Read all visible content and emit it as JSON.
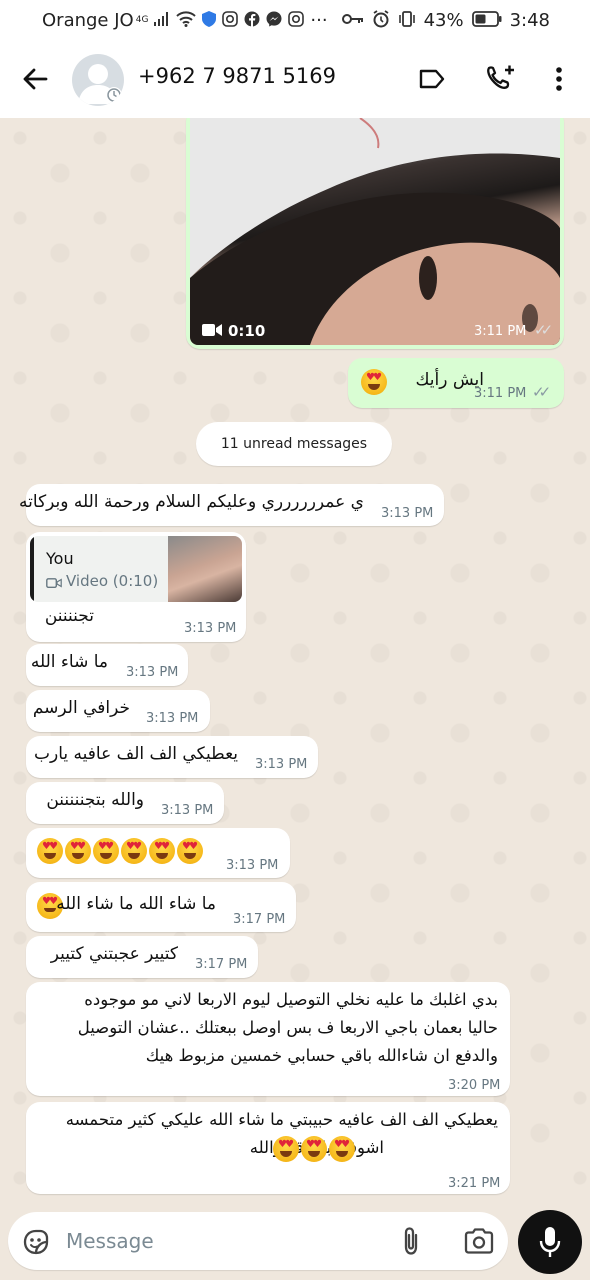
{
  "status_bar": {
    "carrier": "Orange JO",
    "network": "4G",
    "battery": "43%",
    "time": "3:48"
  },
  "header": {
    "contact": "+962 7 9871 5169"
  },
  "video_message": {
    "duration": "0:10",
    "time": "3:11 PM"
  },
  "outgoing_text": {
    "text": "ايش رأيك",
    "time": "3:11 PM"
  },
  "unread_banner": "11 unread messages",
  "reply_quote": {
    "author": "You",
    "label": "Video (0:10)"
  },
  "messages": [
    {
      "text": "ي عمرررررري وعليكم السلام ورحمة الله وبركاته",
      "time": "3:13 PM"
    },
    {
      "text": "تجننننن",
      "time": "3:13 PM"
    },
    {
      "text": "ما شاء الله",
      "time": "3:13 PM"
    },
    {
      "text": "خرافي الرسم",
      "time": "3:13 PM"
    },
    {
      "text": "يعطيكي الف الف عافيه يارب",
      "time": "3:13 PM"
    },
    {
      "text": "والله بتجنننننن",
      "time": "3:13 PM"
    },
    {
      "text": "",
      "time": "3:13 PM"
    },
    {
      "text": "ما شاء الله ما شاء الله",
      "time": "3:17 PM"
    },
    {
      "text": "كتيير عجبتني كتيير",
      "time": "3:17 PM"
    },
    {
      "lines": [
        "بدي اغلبك ما عليه نخلي التوصيل ليوم الاربعا لاني مو موجوده",
        "حاليا بعمان باجي الاربعا ف بس اوصل ببعتلك ..عشان التوصيل",
        "والدفع ان شاءالله  باقي حسابي خمسين مزبوط هيك"
      ],
      "time": "3:20 PM"
    },
    {
      "lines": [
        "يعطيكي الف الف عافيه حبيبتي ما شاء الله عليكي كثير متحمسه",
        "اشوفها بالواقع والله"
      ],
      "time": "3:21 PM"
    }
  ],
  "input": {
    "placeholder": "Message"
  },
  "colors": {
    "outgoing_bubble": "#d9fdd3",
    "incoming_bubble": "#ffffff",
    "chat_background": "#efe7dd"
  }
}
